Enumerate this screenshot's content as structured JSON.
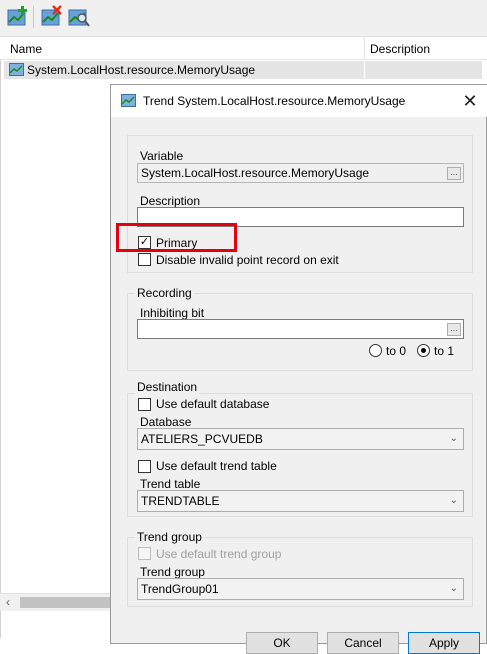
{
  "toolbar": {
    "buttons": [
      {
        "icon": "add-trend-icon"
      },
      {
        "icon": "remove-trend-icon"
      },
      {
        "icon": "properties-trend-icon"
      }
    ]
  },
  "list": {
    "columns": [
      "Name",
      "Description"
    ],
    "rows": [
      {
        "name": "System.LocalHost.resource.MemoryUsage",
        "description": ""
      }
    ]
  },
  "dialog": {
    "title": "Trend System.LocalHost.resource.MemoryUsage",
    "variable_label": "Variable",
    "variable_value": "System.LocalHost.resource.MemoryUsage",
    "description_label": "Description",
    "description_value": "",
    "primary_label": "Primary",
    "primary_checked": true,
    "disable_invalid_label": "Disable invalid point record on exit",
    "disable_invalid_checked": false,
    "recording": {
      "title": "Recording",
      "inhibiting_label": "Inhibiting bit",
      "inhibiting_value": "",
      "to0_label": "to 0",
      "to1_label": "to 1",
      "selected": "to 1"
    },
    "destination": {
      "title": "Destination",
      "use_default_db_label": "Use default database",
      "use_default_db_checked": false,
      "database_label": "Database",
      "database_value": "ATELIERS_PCVUEDB",
      "use_default_table_label": "Use default trend table",
      "use_default_table_checked": false,
      "trend_table_label": "Trend table",
      "trend_table_value": "TRENDTABLE"
    },
    "trend_group": {
      "title": "Trend group",
      "use_default_group_label": "Use default trend group",
      "use_default_group_checked": false,
      "trend_group_label": "Trend group",
      "trend_group_value": "TrendGroup01"
    },
    "buttons": {
      "ok": "OK",
      "cancel": "Cancel",
      "apply": "Apply"
    }
  },
  "colors": {
    "highlight": "#e3000f",
    "dialog_bg": "#f0f0f0"
  }
}
